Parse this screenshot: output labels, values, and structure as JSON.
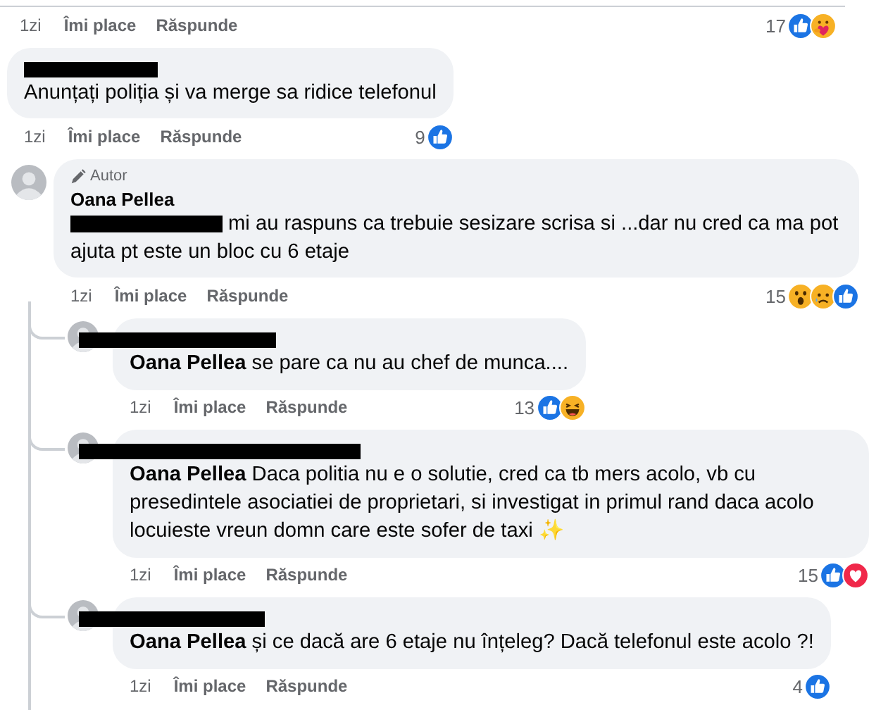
{
  "top_actions": {
    "time": "1zi",
    "like": "Îmi place",
    "reply": "Răspunde",
    "count": "17",
    "reactions": [
      {
        "kind": "like"
      },
      {
        "kind": "care"
      }
    ]
  },
  "comments": [
    {
      "avatar": false,
      "name_redacted": true,
      "text": "Anunțați poliția și va merge sa ridice telefonul",
      "actions": {
        "time": "1zi",
        "like": "Îmi place",
        "reply": "Răspunde",
        "count": "9",
        "reactions": [
          {
            "kind": "like"
          }
        ]
      }
    },
    {
      "avatar": true,
      "badge": "Autor",
      "author": "Oana Pellea",
      "mention_redacted": true,
      "text": "mi au raspuns ca trebuie sesizare scrisa si ...dar nu cred ca ma pot ajuta pt este un bloc cu 6 etaje",
      "actions": {
        "time": "1zi",
        "like": "Îmi place",
        "reply": "Răspunde",
        "count": "15",
        "reactions": [
          {
            "kind": "wow"
          },
          {
            "kind": "sad"
          },
          {
            "kind": "like"
          }
        ]
      },
      "replies": [
        {
          "avatar": true,
          "name_redacted": true,
          "text": "**Oana Pellea** se pare ca nu au chef de munca....",
          "actions": {
            "time": "1zi",
            "like": "Îmi place",
            "reply": "Răspunde",
            "count": "13",
            "reactions": [
              {
                "kind": "like"
              },
              {
                "kind": "haha"
              }
            ]
          }
        },
        {
          "avatar": true,
          "name_redacted": true,
          "text": "**Oana Pellea** Daca politia nu e o solutie, cred ca tb mers acolo, vb cu presedintele asociatiei de proprietari, si investigat in primul rand daca acolo locuieste vreun domn care este sofer de taxi ✨",
          "actions": {
            "time": "1zi",
            "like": "Îmi place",
            "reply": "Răspunde",
            "count": "15",
            "reactions": [
              {
                "kind": "like"
              },
              {
                "kind": "love"
              }
            ]
          }
        },
        {
          "avatar": true,
          "name_redacted": true,
          "text": "**Oana Pellea** și ce dacă are 6 etaje nu înțeleg? Dacă telefonul este acolo ?!",
          "actions": {
            "time": "1zi",
            "like": "Îmi place",
            "reply": "Răspunde",
            "count": "4",
            "reactions": [
              {
                "kind": "like"
              }
            ]
          }
        }
      ]
    }
  ]
}
